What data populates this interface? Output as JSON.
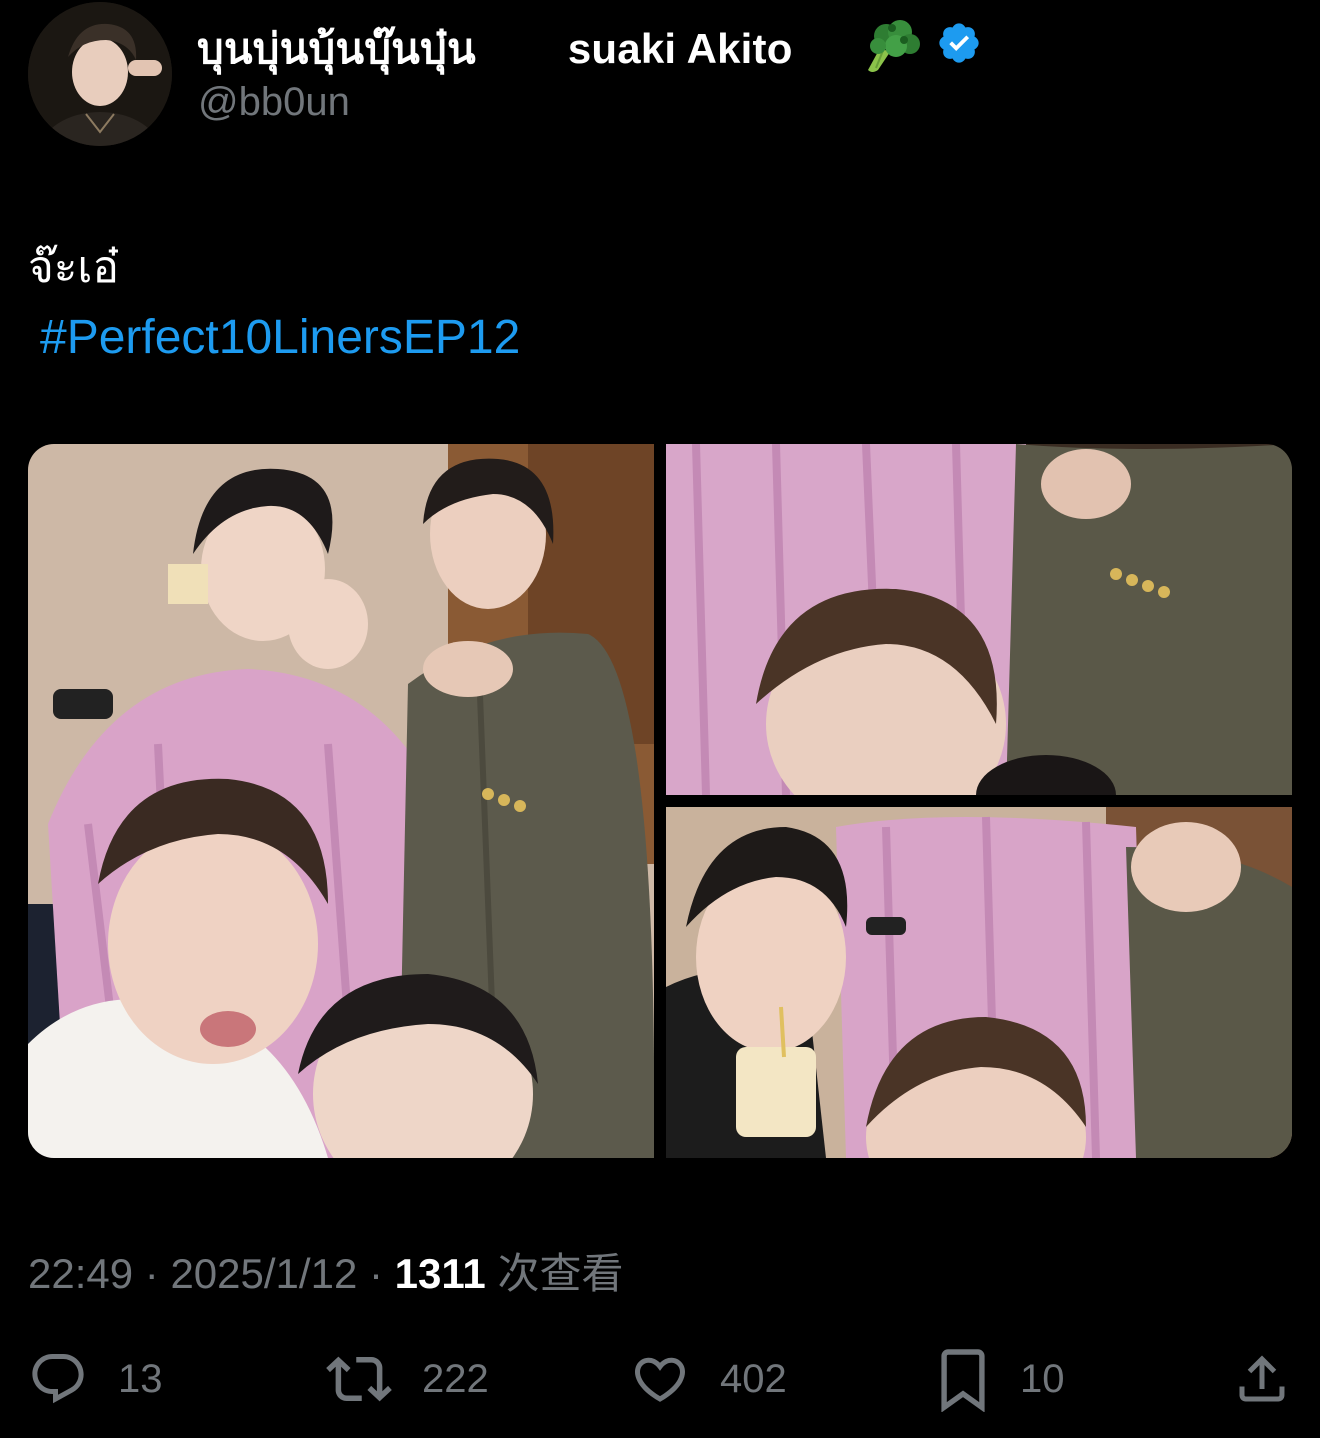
{
  "tweet": {
    "author": {
      "display_name_part1": "บุนบุ่นบุ้นบุ๊นบุ๋น",
      "display_name_part2": "suaki Akito",
      "name_emoji": "broccoli",
      "verified": true,
      "handle": "@bb0un"
    },
    "text": "จ๊ะเอ๋",
    "hashtag": "#Perfect10LinersEP12",
    "media_count": 3,
    "time": "22:49",
    "separator": "·",
    "date": "2025/1/12",
    "views_count": "1311",
    "views_label": "次查看"
  },
  "actions": {
    "reply_count": "13",
    "retweet_count": "222",
    "like_count": "402",
    "bookmark_count": "10"
  },
  "icons": {
    "reply": "reply-icon",
    "retweet": "retweet-icon",
    "like": "heart-icon",
    "bookmark": "bookmark-icon",
    "share": "share-icon",
    "verified": "verified-badge-icon"
  },
  "colors": {
    "background": "#000000",
    "text_primary": "#ffffff",
    "text_secondary": "#71767b",
    "link": "#1d9bf0",
    "verified": "#1d9bf0"
  }
}
